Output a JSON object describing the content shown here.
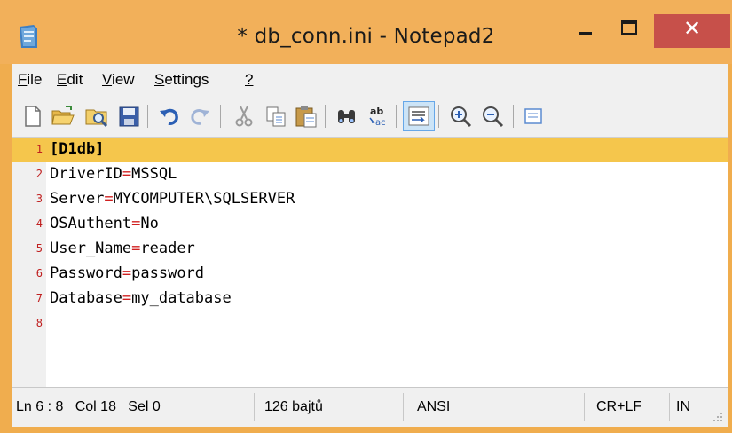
{
  "window": {
    "title": "* db_conn.ini - Notepad2",
    "close_glyph": "✕",
    "colors": {
      "frame": "#f2b05a",
      "close": "#c7504a",
      "current_line": "#f5c64c",
      "operator": "#d02020",
      "line_number": "#c02020"
    }
  },
  "menu": {
    "items": [
      {
        "key": "F",
        "rest": "ile"
      },
      {
        "key": "E",
        "rest": "dit"
      },
      {
        "key": "V",
        "rest": "iew"
      },
      {
        "key": "S",
        "rest": "ettings"
      },
      {
        "key": "?",
        "rest": ""
      }
    ]
  },
  "toolbar": {
    "icons": [
      "new-file-icon",
      "open-folder-icon",
      "browse-icon",
      "save-icon",
      "undo-icon",
      "redo-icon",
      "cut-icon",
      "copy-icon",
      "paste-icon",
      "find-icon",
      "replace-icon",
      "word-wrap-icon",
      "zoom-in-icon",
      "zoom-out-icon",
      "more-icon"
    ]
  },
  "editor": {
    "lines": [
      {
        "num": "1",
        "key": "[D1db]",
        "op": "",
        "value": ""
      },
      {
        "num": "2",
        "key": "DriverID",
        "op": "=",
        "value": "MSSQL"
      },
      {
        "num": "3",
        "key": "Server",
        "op": "=",
        "value": "MYCOMPUTER\\SQLSERVER"
      },
      {
        "num": "4",
        "key": "OSAuthent",
        "op": "=",
        "value": "No"
      },
      {
        "num": "5",
        "key": "User_Name",
        "op": "=",
        "value": "reader"
      },
      {
        "num": "6",
        "key": "Password",
        "op": "=",
        "value": "password"
      },
      {
        "num": "7",
        "key": "Database",
        "op": "=",
        "value": "my_database"
      },
      {
        "num": "8",
        "key": "",
        "op": "",
        "value": ""
      }
    ]
  },
  "status": {
    "position": "Ln 6 : 8   Col 18   Sel 0",
    "size": "126 bajtů",
    "encoding": "ANSI",
    "eol": "CR+LF",
    "mode": "IN"
  }
}
